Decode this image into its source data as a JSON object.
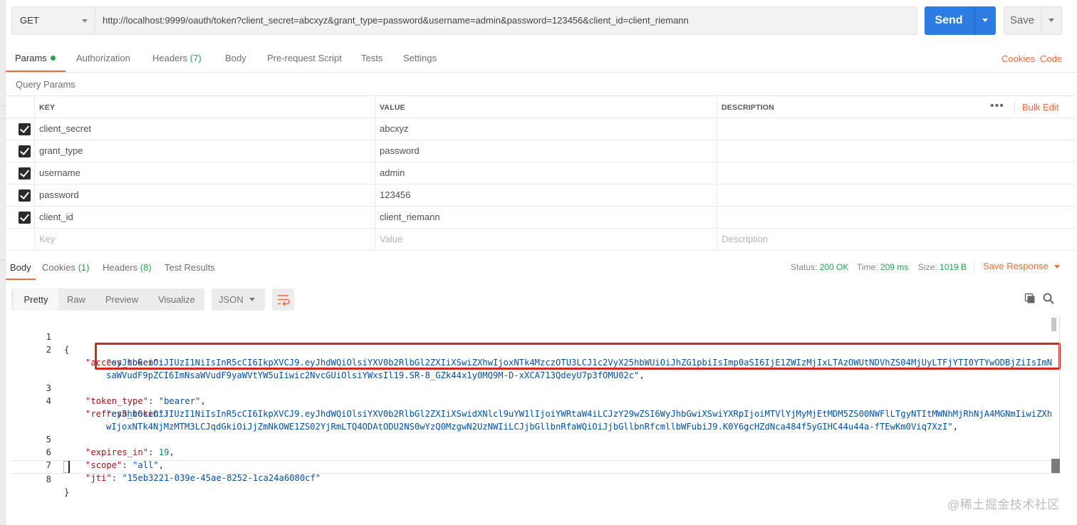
{
  "request": {
    "method": "GET",
    "url": "http://localhost:9999/oauth/token?client_secret=abcxyz&grant_type=password&username=admin&password=123456&client_id=client_riemann",
    "send_label": "Send",
    "save_label": "Save"
  },
  "request_tabs": {
    "params": "Params",
    "authorization": "Authorization",
    "headers": "Headers",
    "headers_count": "(7)",
    "body": "Body",
    "pre_request": "Pre-request Script",
    "tests": "Tests",
    "settings": "Settings",
    "cookies_link": "Cookies",
    "code_link": "Code"
  },
  "query_params": {
    "title": "Query Params",
    "columns": {
      "key": "KEY",
      "value": "VALUE",
      "description": "DESCRIPTION"
    },
    "bulk_edit": "Bulk Edit",
    "rows": [
      {
        "key": "client_secret",
        "value": "abcxyz"
      },
      {
        "key": "grant_type",
        "value": "password"
      },
      {
        "key": "username",
        "value": "admin"
      },
      {
        "key": "password",
        "value": "123456"
      },
      {
        "key": "client_id",
        "value": "client_riemann"
      }
    ],
    "placeholders": {
      "key": "Key",
      "value": "Value",
      "description": "Description"
    }
  },
  "response_tabs": {
    "body": "Body",
    "cookies": "Cookies",
    "cookies_count": "(1)",
    "headers": "Headers",
    "headers_count": "(8)",
    "test_results": "Test Results"
  },
  "response_status": {
    "status_label": "Status:",
    "status_value": "200 OK",
    "time_label": "Time:",
    "time_value": "209 ms",
    "size_label": "Size:",
    "size_value": "1019 B",
    "save_response": "Save Response"
  },
  "view_modes": {
    "pretty": "Pretty",
    "raw": "Raw",
    "preview": "Preview",
    "visualize": "Visualize",
    "format": "JSON"
  },
  "code": {
    "line_numbers": [
      "1",
      "2",
      "3",
      "4",
      "5",
      "6",
      "7",
      "8"
    ],
    "open_brace": "{",
    "close_brace": "}",
    "access_token_key": "\"access_token\"",
    "access_token_value_1": "\"eyJhbGciOiJIUzI1NiIsInR5cCI6IkpXVCJ9.eyJhdWQiOlsiYXV0b2RlbGl2ZXIiXSwiZXhwIjoxNTk4MzczOTU3LCJ1c2VyX25hbWUiOiJhZG1pbiIsImp0aSI6IjE1ZWIzMjIxLTAzOWUtNDVhZS04MjUyLTFjYTI0YTYwODBjZiIsImN",
    "access_token_value_2": "saWVudF9pZCI6ImNsaWVudF9yaWVtYW5uIiwic2NvcGUiOlsiYWxsIl19.SR-8_GZk44x1y0MQ9M-D-xXCA713QdeyU7p3fOMU02c\"",
    "token_type_key": "\"token_type\"",
    "token_type_value": "\"bearer\"",
    "refresh_token_key": "\"refresh_token\"",
    "refresh_token_value_1": "\"eyJhbGciOiJIUzI1NiIsInR5cCI6IkpXVCJ9.eyJhdWQiOlsiYXV0b2RlbGl2ZXIiXSwidXNlcl9uYW1lIjoiYWRtaW4iLCJzY29wZSI6WyJhbGwiXSwiYXRpIjoiMTVlYjMyMjEtMDM5ZS00NWFlLTgyNTItMWNhMjRhNjA4MGNmIiwiZXh",
    "refresh_token_value_2": "wIjoxNTk4NjMzMTM3LCJqdGkiOiJjZmNkOWE1ZS02YjRmLTQ4ODAtODU2NS0wYzQ0MzgwN2UzNWIiLCJjbGllbnRfaWQiOiJjbGllbnRfcmllbWFubiJ9.K0Y6gcHZdNca484f5yGIHC44u44a-fTEwKm0Viq7XzI\"",
    "expires_in_key": "\"expires_in\"",
    "expires_in_value": "19",
    "scope_key": "\"scope\"",
    "scope_value": "\"all\"",
    "jti_key": "\"jti\"",
    "jti_value": "\"15eb3221-039e-45ae-8252-1ca24a6080cf\""
  },
  "watermark": "@稀土掘金技术社区",
  "colors": {
    "accent": "#f26b3a",
    "send": "#2d7ce1",
    "success": "#27a34b",
    "highlight": "#cc2a23"
  }
}
